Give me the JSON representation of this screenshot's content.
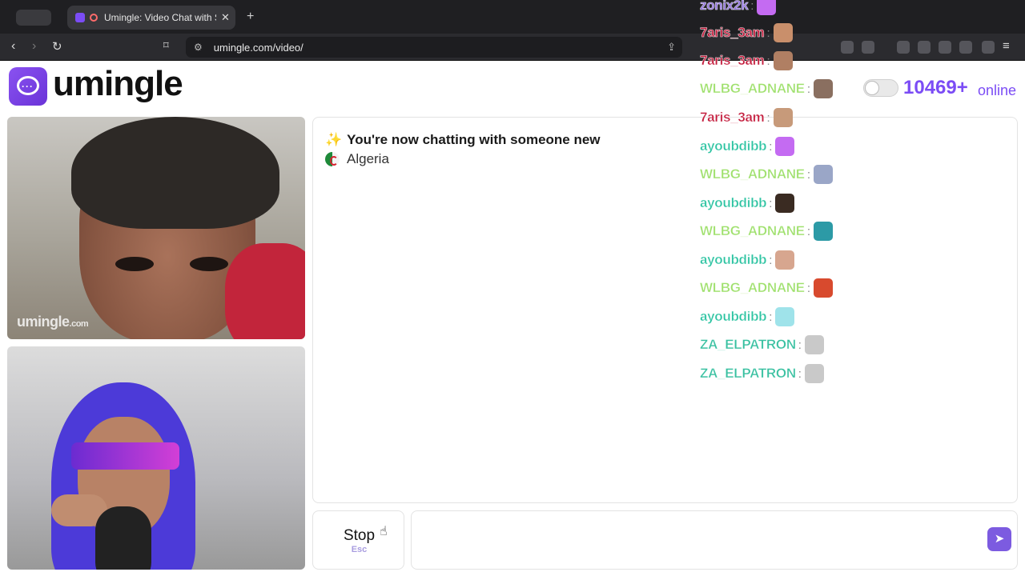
{
  "browser": {
    "tab_title": "Umingle: Video Chat with St",
    "new_tab": "+",
    "url": "umingle.com/video/"
  },
  "site": {
    "logo_text": "umingle",
    "online_count": "10469+",
    "online_label": "online"
  },
  "videos": {
    "watermark_main": "umingle",
    "watermark_tld": ".com"
  },
  "chat": {
    "status": "You're now chatting with someone new",
    "country": "Algeria",
    "stop_label": "Stop",
    "stop_hint": "Esc",
    "input_value": "",
    "input_placeholder": ""
  },
  "overlay_chat": [
    {
      "user": "zonix2k",
      "color": "#8e6fdc",
      "emote_color": "#c46bf2"
    },
    {
      "user": "7aris_3am",
      "color": "#c3193a",
      "emote_color": "#c98f6b"
    },
    {
      "user": "7aris_3am",
      "color": "#c3193a",
      "emote_color": "#b07f63"
    },
    {
      "user": "WLBG_ADNANE",
      "color": "#9ee06b",
      "emote_color": "#8a6f60"
    },
    {
      "user": "7aris_3am",
      "color": "#c3193a",
      "emote_color": "#c79a7a"
    },
    {
      "user": "ayoubdibb",
      "color": "#2bc3a1",
      "emote_color": "#c46bf2"
    },
    {
      "user": "WLBG_ADNANE",
      "color": "#9ee06b",
      "emote_color": "#9aa6c7"
    },
    {
      "user": "ayoubdibb",
      "color": "#2bc3a1",
      "emote_color": "#3a2b22"
    },
    {
      "user": "WLBG_ADNANE",
      "color": "#9ee06b",
      "emote_color": "#2c9aa6"
    },
    {
      "user": "ayoubdibb",
      "color": "#2bc3a1",
      "emote_color": "#d7a68f"
    },
    {
      "user": "WLBG_ADNANE",
      "color": "#9ee06b",
      "emote_color": "#d84a2e"
    },
    {
      "user": "ayoubdibb",
      "color": "#2bc3a1",
      "emote_color": "#9fe3ea"
    },
    {
      "user": "ZA_ELPATRON",
      "color": "#37c0a0",
      "emote_color": "#c9c9c9"
    },
    {
      "user": "ZA_ELPATRON",
      "color": "#37c0a0",
      "emote_color": "#c9c9c9"
    }
  ],
  "colors": {
    "brand": "#7b4cf5",
    "send": "#7c5be0"
  }
}
